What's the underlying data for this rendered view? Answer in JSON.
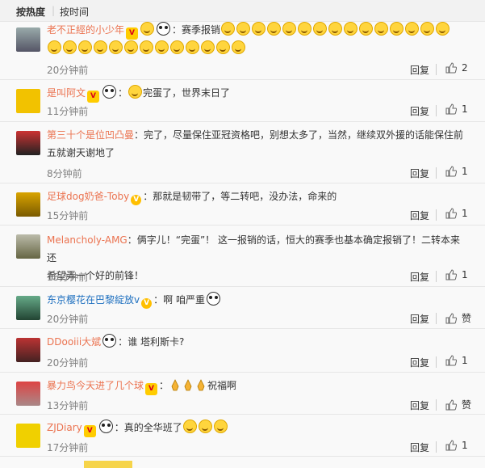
{
  "sort": {
    "hot": "按热度",
    "time": "按时间"
  },
  "reply_label": "回复",
  "like_label": "赞",
  "comments": [
    {
      "user": "老不正經的小少年",
      "text": "赛季报销",
      "time": "20分钟前",
      "likes": "2"
    },
    {
      "user": "是叫阿文",
      "text": "完蛋了，世界末日了",
      "time": "11分钟前",
      "likes": "1"
    },
    {
      "user": "第三十个是位凹凸曼",
      "text": "完了，尽量保住亚冠资格吧，别想太多了，当然，继续双外援的话能保住前",
      "text2": "五就谢天谢地了",
      "time": "8分钟前",
      "likes": "1"
    },
    {
      "user": "足球dog奶爸-Toby",
      "text": "那就是韧带了，等二转吧，没办法，命来的",
      "time": "15分钟前",
      "likes": "1"
    },
    {
      "user": "Melancholy-AMG",
      "text": "俩字儿！“完蛋”！  这一报销的话，恒大的赛季也基本确定报销了！二转本来还",
      "text2": "希望弄一个好的前锋！",
      "time": "15分钟前",
      "likes": "1"
    },
    {
      "user": "东京樱花在巴黎綻放v",
      "text": "啊 咱严重",
      "time": "20分钟前",
      "likes": ""
    },
    {
      "user": "DDooiii大斌",
      "text": "谁 塔利斯卡?",
      "time": "20分钟前",
      "likes": "1"
    },
    {
      "user": "暴力鸟今天进了几个球",
      "text": "祝福啊",
      "time": "13分钟前",
      "likes": ""
    },
    {
      "user": "ZJDiary",
      "text": "真的全华班了",
      "time": "17分钟前",
      "likes": "1"
    }
  ],
  "colors": {
    "username": "#eb7350",
    "link": "#1d6fbf"
  }
}
